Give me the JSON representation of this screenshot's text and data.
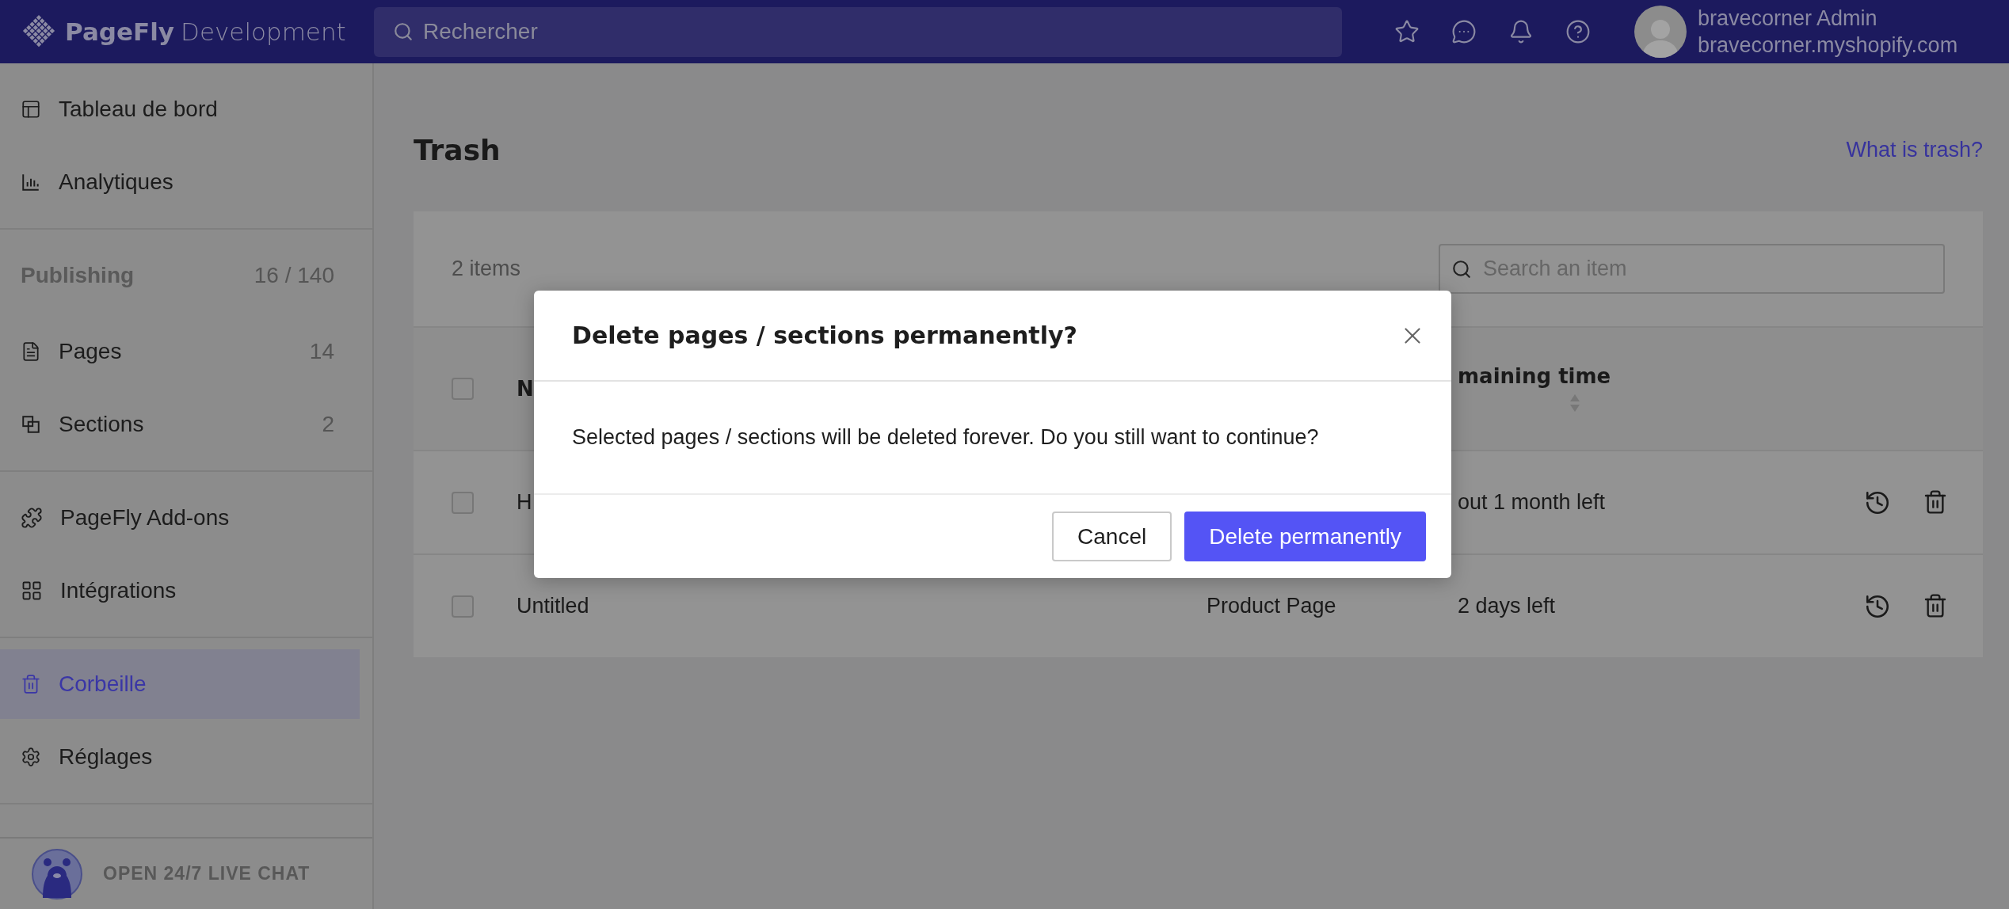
{
  "topbar": {
    "brand": "PageFly",
    "brand_suffix": "Development",
    "search": {
      "placeholder": "Rechercher"
    },
    "user": {
      "name": "bravecorner Admin",
      "shop": "bravecorner.myshopify.com"
    }
  },
  "sidebar": {
    "groups": [
      {
        "items": [
          {
            "label": "Tableau de bord",
            "selected": false
          },
          {
            "label": "Analytiques",
            "selected": false
          }
        ]
      },
      {
        "heading": {
          "label": "Publishing",
          "count": "16 / 140"
        },
        "items": [
          {
            "label": "Pages",
            "count": "14",
            "selected": false
          },
          {
            "label": "Sections",
            "count": "2",
            "selected": false
          }
        ]
      },
      {
        "items": [
          {
            "label": "PageFly Add-ons",
            "selected": false
          },
          {
            "label": "Intégrations",
            "selected": false
          }
        ]
      },
      {
        "items": [
          {
            "label": "Corbeille",
            "selected": true
          },
          {
            "label": "Réglages",
            "selected": false
          }
        ]
      }
    ],
    "live_chat": "OPEN 24/7 LIVE CHAT"
  },
  "main": {
    "title": "Trash",
    "help_link": "What is trash?",
    "count": "2 items",
    "search": {
      "placeholder": "Search an item"
    },
    "table": {
      "header": {
        "selected": false,
        "name_column": "N",
        "time_column": "maining time"
      },
      "rows": [
        {
          "selected": false,
          "name": "H",
          "time": "out 1 month left"
        },
        {
          "selected": false,
          "name": "Untitled",
          "type": "Product Page",
          "time": "2 days left"
        }
      ]
    }
  },
  "dialog": {
    "title": "Delete pages / sections permanently?",
    "message": "Selected pages / sections will be deleted forever. Do you still want to continue?",
    "buttons": [
      {
        "label": "Cancel",
        "kind": "secondary"
      },
      {
        "label": "Delete permanently",
        "kind": "primary"
      }
    ]
  }
}
